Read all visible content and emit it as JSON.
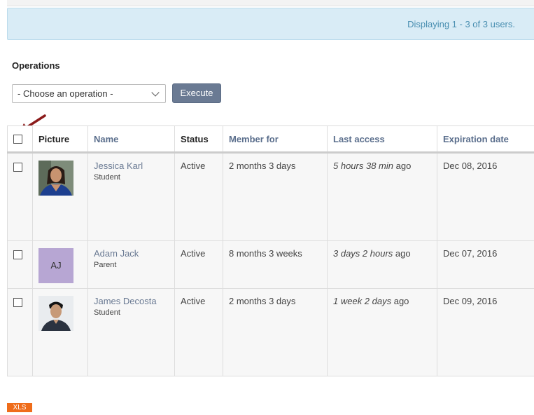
{
  "info": {
    "displaying": "Displaying 1 - 3 of 3 users."
  },
  "operations": {
    "title": "Operations",
    "select_value": "- Choose an operation -",
    "execute_label": "Execute"
  },
  "table": {
    "headers": {
      "picture": "Picture",
      "name": "Name",
      "status": "Status",
      "member_for": "Member for",
      "last_access": "Last access",
      "expiration": "Expiration date"
    },
    "rows": [
      {
        "name": "Jessica Karl",
        "role": "Student",
        "picture": "photo",
        "status": "Active",
        "member_for": "2 months 3 days",
        "last_access_italic": "5 hours 38 min",
        "last_access_suffix": " ago",
        "expiration": "Dec 08, 2016"
      },
      {
        "name": "Adam Jack",
        "role": "Parent",
        "picture": "initials",
        "initials": "AJ",
        "status": "Active",
        "member_for": "8 months 3 weeks",
        "last_access_italic": "3 days 2 hours",
        "last_access_suffix": " ago",
        "expiration": "Dec 07, 2016"
      },
      {
        "name": "James Decosta",
        "role": "Student",
        "picture": "photo",
        "status": "Active",
        "member_for": "2 months 3 days",
        "last_access_italic": "1 week 2 days",
        "last_access_suffix": " ago",
        "expiration": "Dec 09, 2016"
      }
    ]
  },
  "export": {
    "xls_label": "XLS"
  },
  "colors": {
    "accent": "#6a7a93",
    "info_bg": "#d9ecf6",
    "arrow": "#8b1a1a",
    "xls": "#ef6c1a"
  },
  "icons": {
    "annotation": "red-arrow-icon",
    "dropdown": "chevron-down-icon"
  }
}
